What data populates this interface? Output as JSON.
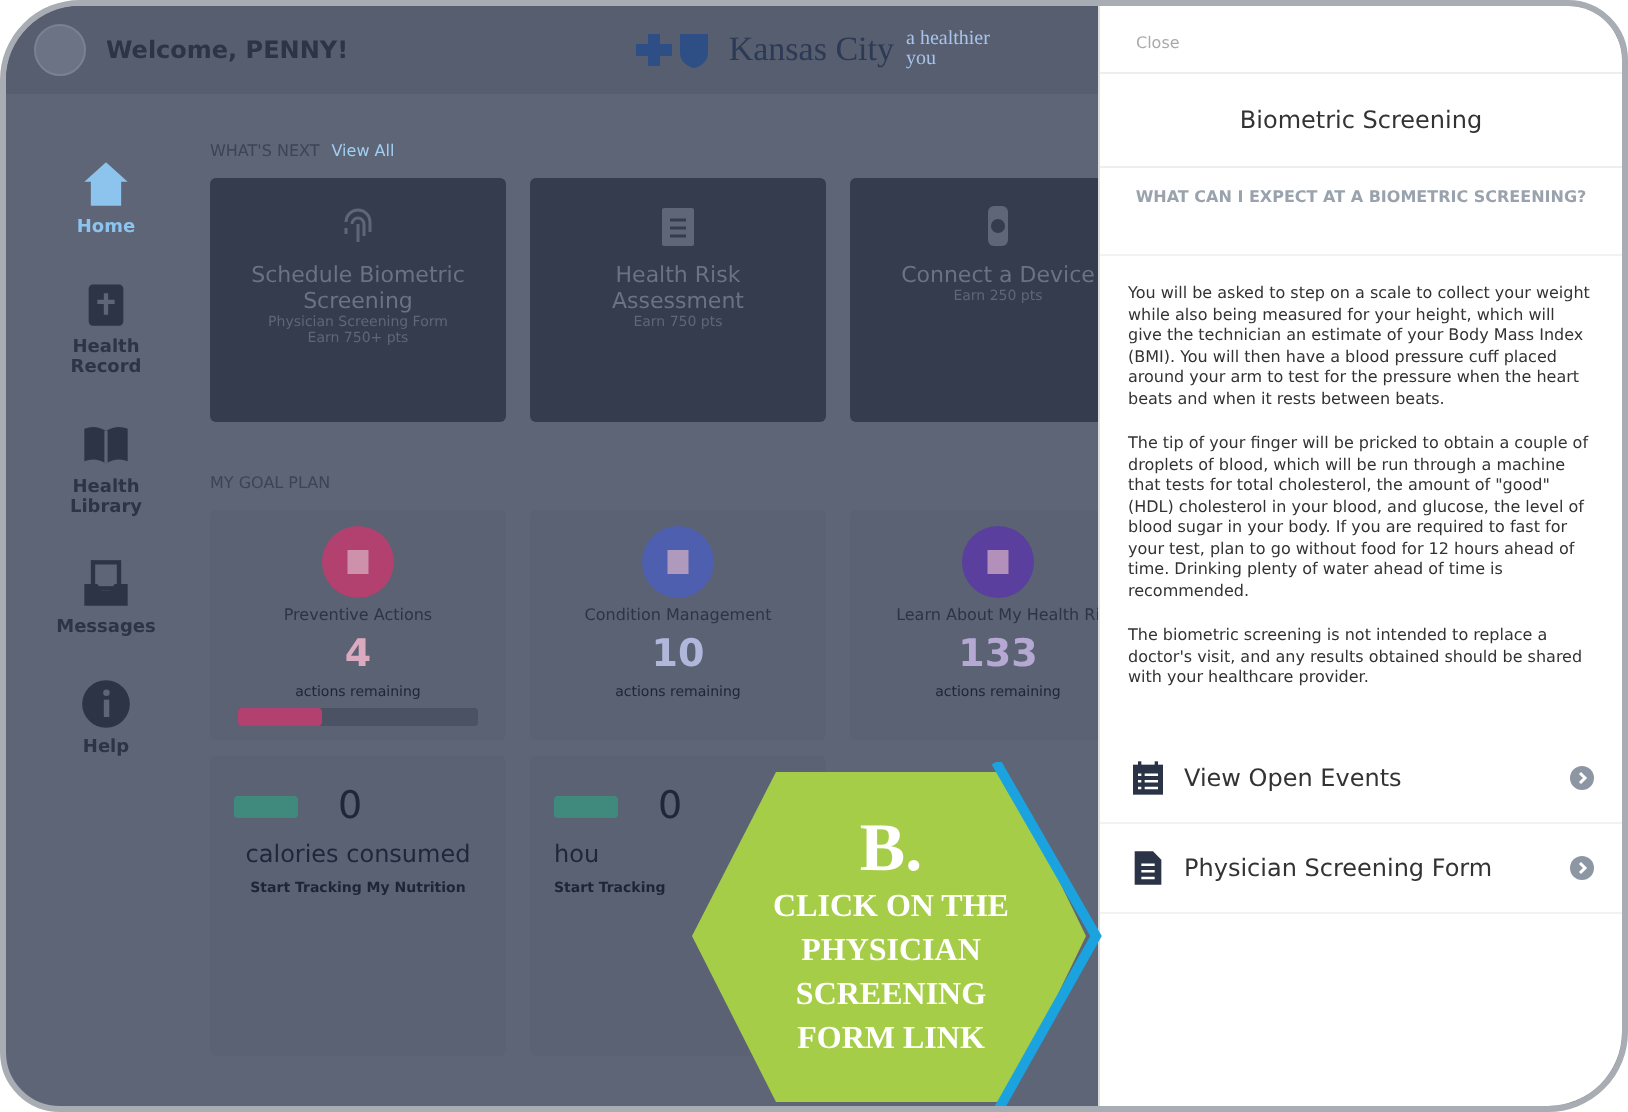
{
  "header": {
    "welcome": "Welcome, PENNY!",
    "logo_text": "Kansas City",
    "tagline": "a healthier you"
  },
  "sidebar": {
    "items": [
      {
        "label": "Home",
        "selected": true
      },
      {
        "label": "Health Record",
        "selected": false
      },
      {
        "label": "Health Library",
        "selected": false
      },
      {
        "label": "Messages",
        "selected": false
      },
      {
        "label": "Help",
        "selected": false
      }
    ]
  },
  "whats_next": {
    "title": "WHAT'S NEXT",
    "link": "View All",
    "cards": [
      {
        "title": "Schedule Biometric Screening",
        "subtitle": "Physician Screening Form",
        "points": "Earn 750+ pts"
      },
      {
        "title": "Health Risk Assessment",
        "points": "Earn 750 pts"
      },
      {
        "title": "Connect a Device",
        "points": "Earn 250 pts"
      }
    ]
  },
  "goal_plan": {
    "title": "MY GOAL PLAN",
    "cards": [
      {
        "title": "Preventive Actions",
        "count": "4",
        "caption": "actions remaining",
        "color": "#b2416f",
        "level": 0.35
      },
      {
        "title": "Condition Management",
        "count": "10",
        "caption": "actions remaining",
        "color": "#4f5fb0"
      },
      {
        "title": "Learn About My Health Ri",
        "count": "133",
        "caption": "actions remaining",
        "color": "#5a3f9e"
      }
    ]
  },
  "trackers": [
    {
      "value": "0",
      "unit": "calories consumed",
      "action": "Start Tracking My Nutrition"
    },
    {
      "value": "0",
      "unit": "hou",
      "action": "Start Tracking"
    }
  ],
  "panel": {
    "close": "Close",
    "title": "Biometric Screening",
    "heading": "WHAT CAN I EXPECT AT A BIOMETRIC SCREENING?",
    "paragraphs": [
      "You will be asked to step on a scale to collect your weight while also being measured for your height, which will give the technician an estimate of your Body Mass Index (BMI). You will then have a blood pressure cuff placed around your arm to test for the pressure when the heart beats and when it rests between beats.",
      "The tip of your finger will be pricked to obtain a couple of droplets of blood, which will be run through a machine that tests for total cholesterol, the amount of \"good\" (HDL) cholesterol in your blood, and glucose, the level of blood sugar in your body. If you are required to fast for your test, plan to go without food for 12 hours ahead of time. Drinking plenty of water ahead of time is recommended.",
      "The biometric screening is not intended to replace a doctor's visit, and any results obtained should be shared with your healthcare provider."
    ],
    "links": [
      {
        "label": "View Open Events"
      },
      {
        "label": "Physician Screening Form"
      }
    ]
  },
  "callout": {
    "letter": "B.",
    "text": "CLICK ON THE PHYSICIAN SCREENING FORM LINK"
  }
}
